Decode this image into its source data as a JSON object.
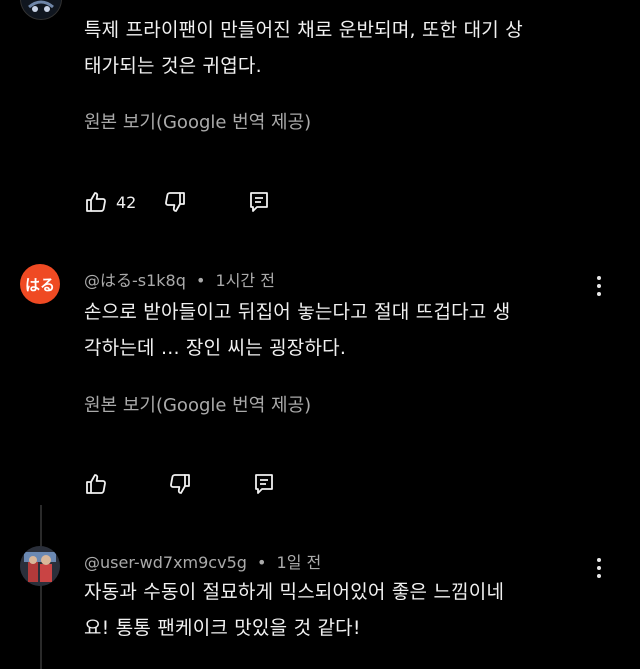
{
  "comments": [
    {
      "body_line1": "특제 프라이팬이 만들어진 채로 운반되며, 또한 대기 상",
      "body_line2": "태가되는 것은 귀엽다.",
      "translate_label": "원본 보기(Google 번역 제공)",
      "like_count": "42"
    },
    {
      "avatar_text": "はる",
      "author": "@はる-s1k8q",
      "separator": "•",
      "time": "1시간 전",
      "body_line1": "손으로 받아들이고 뒤집어 놓는다고 절대 뜨겁다고 생",
      "body_line2": "각하는데 ... 장인 씨는 굉장하다.",
      "translate_label": "원본 보기(Google 번역 제공)"
    },
    {
      "author": "@user-wd7xm9cv5g",
      "separator": "•",
      "time": "1일 전",
      "body_line1": "자동과 수동이 절묘하게 믹스되어있어 좋은 느낌이네",
      "body_line2": "요! 통통 팬케이크 맛있을 것 같다!"
    }
  ],
  "icons": {
    "like": "thumb-up-icon",
    "dislike": "thumb-down-icon",
    "reply": "reply-icon",
    "more": "more-vertical-icon"
  },
  "colors": {
    "background": "#000000",
    "text_primary": "#f1f1f1",
    "text_secondary": "#aaaaaa",
    "avatar_orange": "#ef4a23"
  }
}
